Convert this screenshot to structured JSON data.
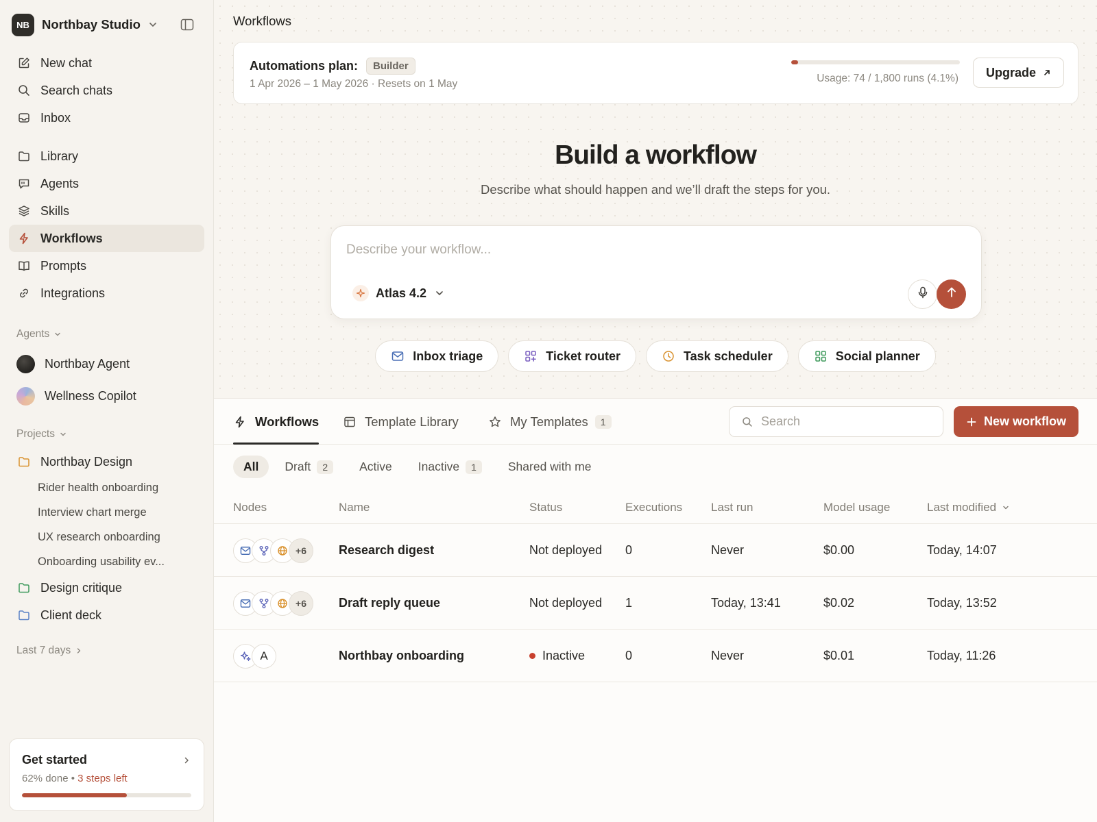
{
  "workspace": {
    "initials": "NB",
    "name": "Northbay Studio"
  },
  "nav": {
    "primary": [
      {
        "label": "New chat",
        "icon": "edit-icon"
      },
      {
        "label": "Search chats",
        "icon": "search-icon"
      },
      {
        "label": "Inbox",
        "icon": "inbox-icon"
      }
    ],
    "secondary": [
      {
        "label": "Library",
        "icon": "folder-icon"
      },
      {
        "label": "Agents",
        "icon": "chat-icon"
      },
      {
        "label": "Skills",
        "icon": "layers-icon"
      },
      {
        "label": "Workflows",
        "icon": "bolt-icon",
        "active": true
      },
      {
        "label": "Prompts",
        "icon": "book-icon"
      },
      {
        "label": "Integrations",
        "icon": "link-icon"
      }
    ]
  },
  "agents_section": {
    "label": "Agents",
    "items": [
      {
        "label": "Northbay Agent"
      },
      {
        "label": "Wellness Copilot"
      }
    ]
  },
  "projects_section": {
    "label": "Projects",
    "items": [
      {
        "label": "Northbay Design",
        "color": "#d9922f",
        "children": [
          "Rider health onboarding",
          "Interview chart merge",
          "UX research onboarding",
          "Onboarding usability ev..."
        ]
      },
      {
        "label": "Design critique",
        "color": "#3f9a5c"
      },
      {
        "label": "Client deck",
        "color": "#5a82c6"
      }
    ]
  },
  "last7": {
    "label": "Last 7 days"
  },
  "get_started": {
    "title": "Get started",
    "progress_text": "62% done",
    "separator": "•",
    "steps_left": "3 steps left",
    "progress": 0.62
  },
  "page": {
    "title": "Workflows"
  },
  "plan": {
    "label": "Automations plan:",
    "tier": "Builder",
    "dates": "1 Apr 2026 – 1 May 2026 · Resets on 1 May",
    "usage_text": "Usage: 74 / 1,800 runs (4.1%)",
    "usage_fraction": 0.041,
    "upgrade_label": "Upgrade"
  },
  "hero": {
    "title": "Build a workflow",
    "subtitle": "Describe what should happen and we’ll draft the steps for you."
  },
  "composer": {
    "placeholder": "Describe your workflow...",
    "model": "Atlas 4.2"
  },
  "suggestions": [
    {
      "label": "Inbox triage",
      "icon": "mail-icon"
    },
    {
      "label": "Ticket router",
      "icon": "grid-plus-icon"
    },
    {
      "label": "Task scheduler",
      "icon": "clock-icon"
    },
    {
      "label": "Social planner",
      "icon": "grid-icon"
    }
  ],
  "tabs": {
    "workflows": "Workflows",
    "template_library": "Template Library",
    "my_templates": "My Templates",
    "my_templates_count": "1"
  },
  "search": {
    "placeholder": "Search"
  },
  "new_workflow_label": "New workflow",
  "filters": {
    "all": "All",
    "draft": "Draft",
    "draft_count": "2",
    "active": "Active",
    "inactive": "Inactive",
    "inactive_count": "1",
    "shared": "Shared with me"
  },
  "table": {
    "headers": {
      "nodes": "Nodes",
      "name": "Name",
      "status": "Status",
      "executions": "Executions",
      "last_run": "Last run",
      "model_usage": "Model usage",
      "last_modified": "Last modified"
    },
    "rows": [
      {
        "nodes_extra": "+6",
        "name": "Research digest",
        "status": "Not deployed",
        "executions": "0",
        "last_run": "Never",
        "model_usage": "$0.00",
        "last_modified": "Today, 14:07"
      },
      {
        "nodes_extra": "+6",
        "name": "Draft reply queue",
        "status": "Not deployed",
        "executions": "1",
        "last_run": "Today, 13:41",
        "model_usage": "$0.02",
        "last_modified": "Today, 13:52"
      },
      {
        "node_letter": "A",
        "name": "Northbay onboarding",
        "status": "Inactive",
        "executions": "0",
        "last_run": "Never",
        "model_usage": "$0.01",
        "last_modified": "Today, 11:26"
      }
    ]
  },
  "colors": {
    "accent": "#b5503a",
    "inactive_dot": "#c8402e"
  }
}
